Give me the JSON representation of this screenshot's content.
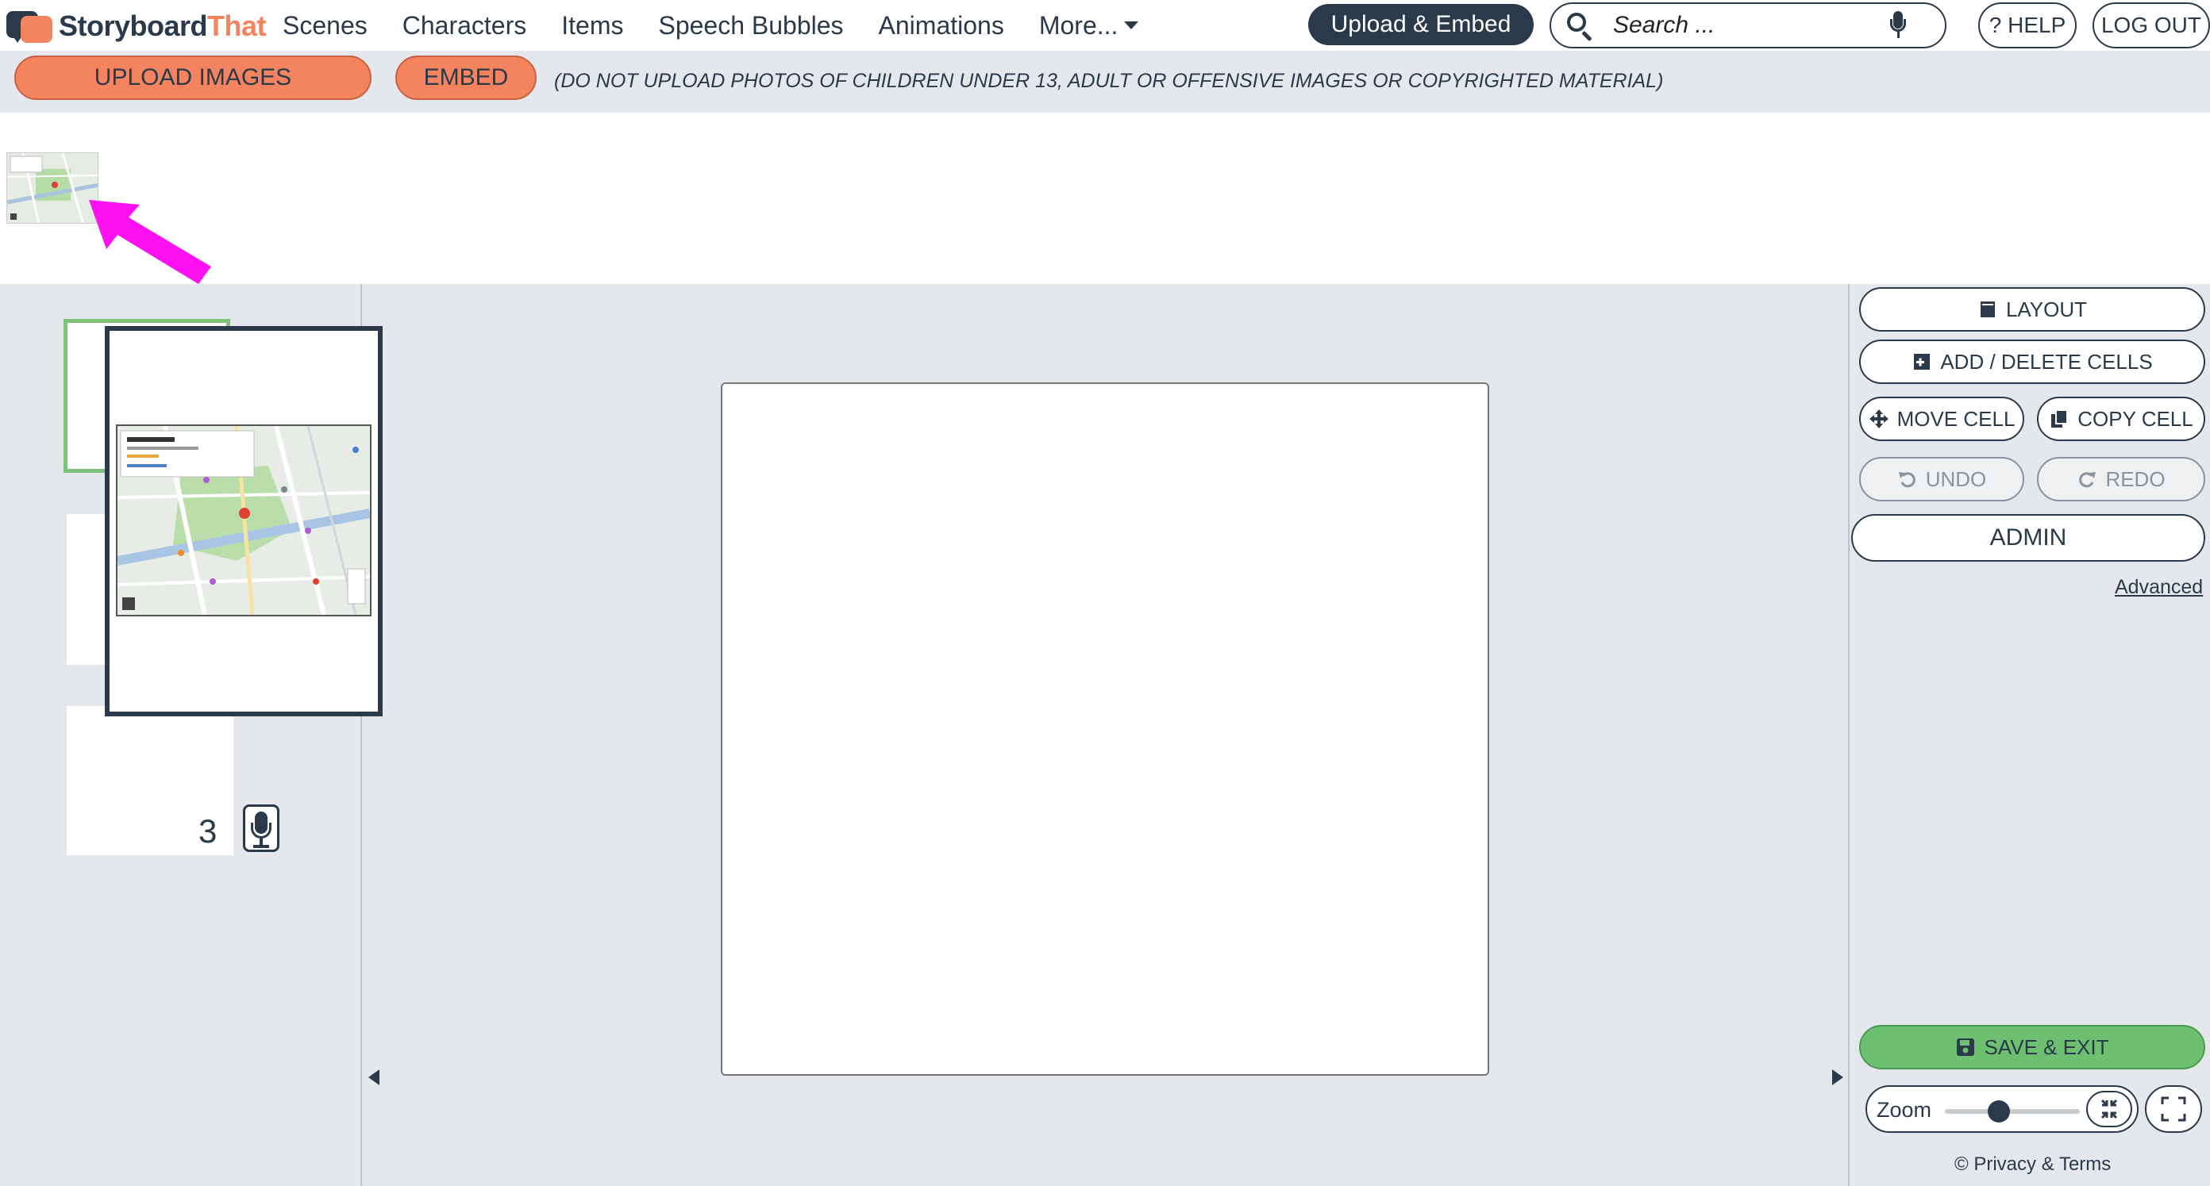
{
  "brand": {
    "name_part1": "Storyboard",
    "name_part2": "That",
    "color_dark": "#2b3a4a",
    "color_accent": "#f4845f"
  },
  "nav": {
    "items": [
      "Scenes",
      "Characters",
      "Items",
      "Speech Bubbles",
      "Animations"
    ],
    "more_label": "More...",
    "upload_embed_label": "Upload & Embed",
    "help_label": "? HELP",
    "logout_label": "LOG OUT"
  },
  "search": {
    "placeholder": "Search ..."
  },
  "upload_bar": {
    "upload_images_label": "UPLOAD IMAGES",
    "embed_label": "EMBED",
    "disclaimer": "(DO NOT UPLOAD PHOTOS OF CHILDREN UNDER 13, ADULT OR OFFENSIVE IMAGES OR COPYRIGHTED MATERIAL)"
  },
  "cells": {
    "third_cell_number": "3"
  },
  "right_panel": {
    "layout_label": "LAYOUT",
    "add_delete_label": "ADD / DELETE CELLS",
    "move_cell_label": "MOVE CELL",
    "copy_cell_label": "COPY CELL",
    "undo_label": "UNDO",
    "redo_label": "REDO",
    "admin_label": "ADMIN",
    "advanced_label": "Advanced",
    "save_exit_label": "SAVE & EXIT",
    "zoom_label": "Zoom",
    "zoom_level": 0.4,
    "privacy_label": "© Privacy & Terms"
  },
  "colors": {
    "highlight_arrow": "#ff10f0",
    "active_cell_border": "#7dc47a",
    "save_green": "#6cc070"
  }
}
